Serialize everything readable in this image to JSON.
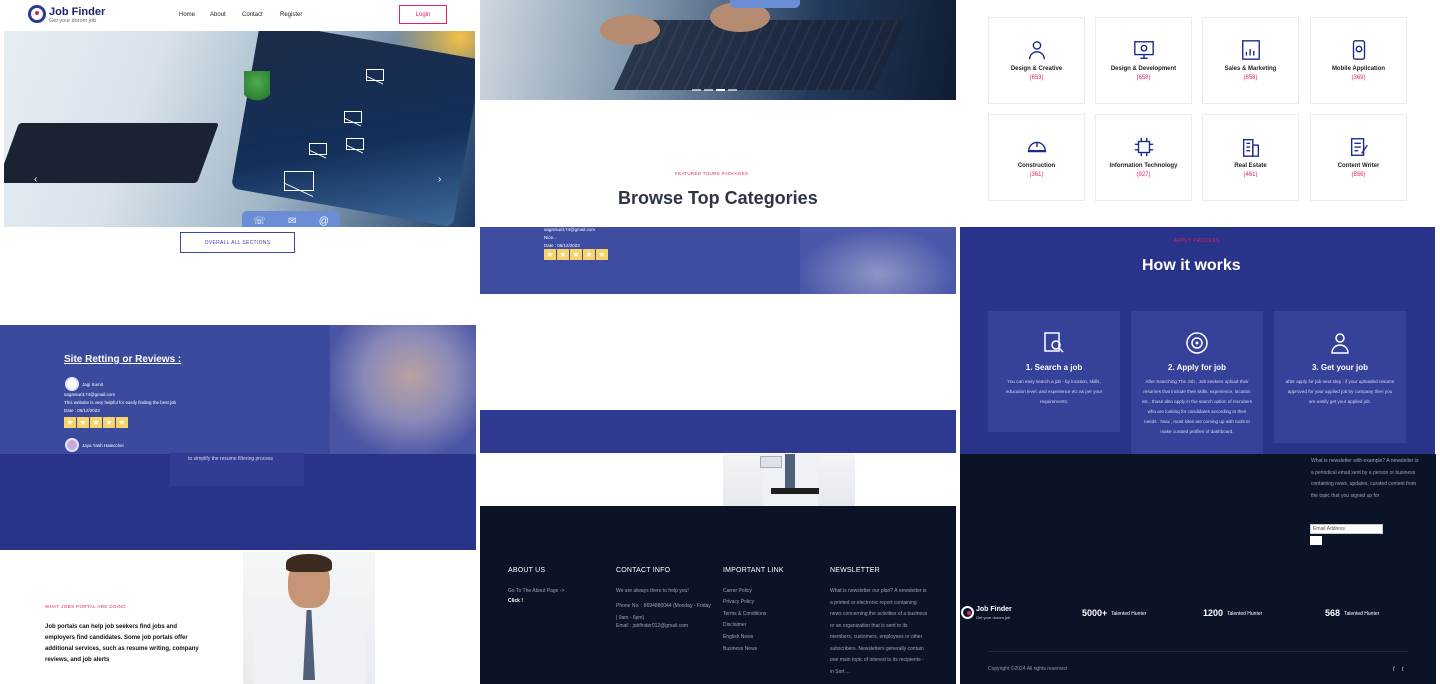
{
  "brand": {
    "name": "Job Finder",
    "tagline": "Get your dorom job"
  },
  "nav": {
    "links": [
      "Home",
      "About",
      "Contact",
      "Register"
    ],
    "login_label": "Login"
  },
  "hero": {
    "prev_arrow": "‹",
    "next_arrow": "›"
  },
  "buttons": {
    "view_all_sections": "OVERALL ALL SECTIONS"
  },
  "reviews": {
    "title": "Site Retting or Reviews :",
    "items": [
      {
        "name": "Jagi Sumit",
        "email": "sagarsuri174@gmail.com",
        "text": "This website is very helpful for easily finding the best job",
        "date": "Date : 05/12/2023",
        "stars": 5
      },
      {
        "name": "Jaya Yash Halecchei",
        "email": "",
        "text": "",
        "date": "",
        "stars": 0
      }
    ],
    "second_block_lines": [
      "sagarsuri174@gmail.com",
      "Nice...",
      "Date : 05/12/2023"
    ],
    "card_text": "to simplify the resume filtering process"
  },
  "about": {
    "kicker": "WHAT JOBS PORTAL ARE DOING",
    "text": "Job portals can help job seekers find jobs and employers find candidates. Some job portals offer additional services, such as resume writing, company reviews, and job alerts"
  },
  "categories": {
    "kicker": "FEATURED TOURS PACKAGES",
    "title": "Browse Top Categories",
    "items": [
      {
        "name": "Design & Creative",
        "count": "(653)",
        "icon": "designer-icon"
      },
      {
        "name": "Design & Development",
        "count": "(658)",
        "icon": "monitor-gear-icon"
      },
      {
        "name": "Sales & Marketing",
        "count": "(658)",
        "icon": "chart-report-icon"
      },
      {
        "name": "Mobile Application",
        "count": "(369)",
        "icon": "mobile-gear-icon"
      },
      {
        "name": "Construction",
        "count": "(361)",
        "icon": "hard-hat-icon"
      },
      {
        "name": "Information Technology",
        "count": "(927)",
        "icon": "chip-icon"
      },
      {
        "name": "Real Estate",
        "count": "(461)",
        "icon": "building-icon"
      },
      {
        "name": "Content Writer",
        "count": "(856)",
        "icon": "document-pen-icon"
      }
    ]
  },
  "how": {
    "kicker": "APPLY PROCESS",
    "title": "How it works",
    "steps": [
      {
        "title": "1. Search a job",
        "text": "You can easy search a job - by location, skills, education level, and experience etc as per your requirements.",
        "icon": "search-document-icon"
      },
      {
        "title": "2. Apply for job",
        "text": "After Searching The Job , Job seekers upload their resumes that include their skills, experience, location etc , those also apply in the search option of recruiters who are looking for candidates according to their needs . Now , most sites are coming up with tools to make curated profiles of dashboard.",
        "icon": "target-icon"
      },
      {
        "title": "3. Get your job",
        "text": "after apply for job next step : if your uploaded resume approved for your applied job by company then you are easily get your applied job.",
        "icon": "person-badge-icon"
      }
    ]
  },
  "footer": {
    "about_title": "ABOUT US",
    "about_text": "Go To The About Page ->",
    "about_link": "Click !",
    "contact_title": "CONTACT INFO",
    "contact_lines": [
      "We are always there to help you!",
      "Phone No. : 8694880044 (Monday - Friday | 9am - 6pm)",
      "Email : jobfinder012@gmail.com"
    ],
    "links_title": "IMPORTANT LINK",
    "links": [
      "Carrer Policy",
      "Privacy Policy",
      "Terms & Conditions",
      "Disclaimer",
      "English News",
      "Business News"
    ],
    "news_title": "NEWSLETTER",
    "news_text": "What is newsletter our plan? A newsletter is a printed or electronic report containing news concerning the activities of a business or an organization that is sent to its members, customers, employees or other subscribers. Newsletters generally contain one main topic of interest to its recipients - in Sort ...",
    "news_text_right": "What is newsletter with example? A newsletter is a periodical email sent by a person or business containing news, updates, curated content from the topic that you signed up for",
    "email_placeholder": "Email Address",
    "stats": [
      {
        "num": "5000+",
        "label": "Talented Hunter"
      },
      {
        "num": "1200",
        "label": "Talented Hunter"
      },
      {
        "num": "568",
        "label": "Talented Hunter"
      }
    ],
    "copyright": "Copyright ©2024 All rights reserved",
    "social": [
      "f",
      "t"
    ]
  },
  "colors": {
    "accent": "#e0245e",
    "navy": "#2a338a",
    "footer": "#0b1326"
  }
}
